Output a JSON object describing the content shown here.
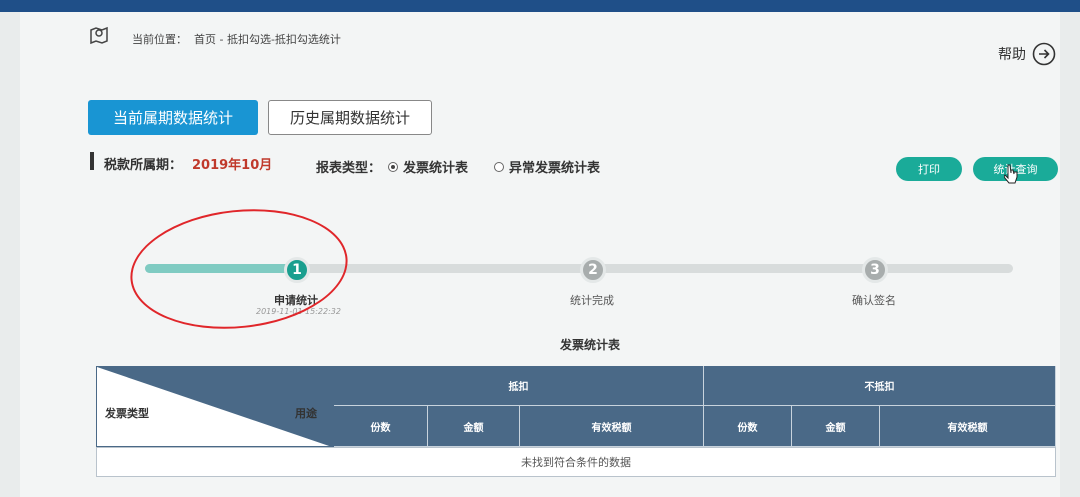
{
  "breadcrumb": {
    "prefix": "当前位置：",
    "path": "首页 - 抵扣勾选-抵扣勾选统计",
    "icon": "map-location-icon"
  },
  "help": {
    "label": "帮助",
    "icon": "arrow-circle-right-icon"
  },
  "tabs": [
    {
      "label": "当前属期数据统计",
      "active": true
    },
    {
      "label": "历史属期数据统计",
      "active": false
    }
  ],
  "filters": {
    "period_label": "税款所属期：",
    "period_value": "2019年10月",
    "report_label": "报表类型：",
    "options": [
      {
        "label": "发票统计表",
        "checked": true
      },
      {
        "label": "异常发票统计表",
        "checked": false
      }
    ]
  },
  "buttons": {
    "print": "打印",
    "query": "统计查询"
  },
  "progress": {
    "completed_fraction": 0.17,
    "steps": [
      {
        "number": "1",
        "label": "申请统计",
        "time": "2019-11-01 15:22:32",
        "state": "done"
      },
      {
        "number": "2",
        "label": "统计完成",
        "state": "pending"
      },
      {
        "number": "3",
        "label": "确认签名",
        "state": "pending"
      }
    ]
  },
  "table": {
    "title": "发票统计表",
    "corner_left": "发票类型",
    "corner_right": "用途",
    "group_deduct": "抵扣",
    "group_nondeduct": "不抵扣",
    "sub_count": "份数",
    "sub_amount": "金额",
    "sub_tax": "有效税额",
    "empty_text": "未找到符合条件的数据"
  },
  "colors": {
    "primary_tab": "#1995d3",
    "action_button": "#1aab99",
    "table_header": "#4a6987",
    "period_value": "#c0392b",
    "annotation": "#e0262a"
  }
}
